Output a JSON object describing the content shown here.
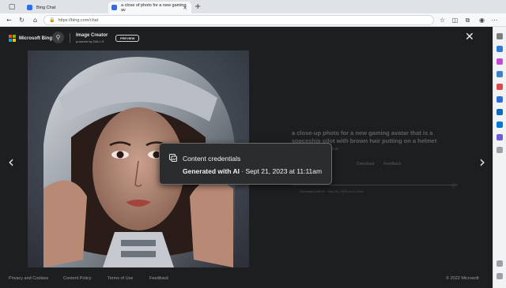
{
  "browser": {
    "tabs": [
      {
        "label": "Bing Chat",
        "active": false
      },
      {
        "label": "a close of photo for a new gaming av",
        "active": true
      }
    ],
    "new_tab": "+",
    "close_tab": "×",
    "address": "https://bing.com/chat"
  },
  "header": {
    "brand": "Microsoft Bing",
    "product_title": "Image Creator",
    "product_sub": "powered by DALL·E",
    "badge": "PREVIEW",
    "close": "✕"
  },
  "viewer": {
    "prev_arrow": "‹",
    "next_arrow": "›",
    "image_alt": "a close-up photo for a new gaming avatar that is a spaceship pilot with brown hair putting on a helmet"
  },
  "details": {
    "title": "a close-up photo for a new gaming avatar that is a spaceship pilot with brown hair putting on a helmet",
    "meta": "1024x1024 jpg · Created now",
    "actions": {
      "share": "Share",
      "save": "Save",
      "download": "Download",
      "feedback": "Feedback"
    },
    "credit": "Generated with AI · Sept 21, 2023 at 11:11am"
  },
  "popup": {
    "title": "Content credentials",
    "strong": "Generated with AI",
    "rest": " · Sept 21, 2023 at 11:11am"
  },
  "footer": {
    "links": [
      "Privacy and Cookies",
      "Content Policy",
      "Terms of Use",
      "Feedback"
    ],
    "copyright": "© 2022 Microsoft"
  },
  "colors": {
    "ms_red": "#f25022",
    "ms_green": "#7fba00",
    "ms_blue": "#00a4ef",
    "ms_yellow": "#ffb900",
    "tab_favicon": "#2f6ee8"
  }
}
